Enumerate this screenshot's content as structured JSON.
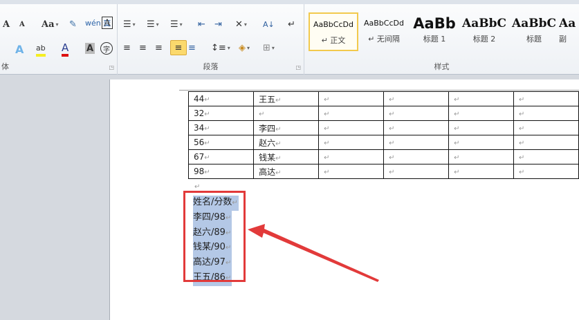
{
  "ribbon": {
    "font_group": {
      "label": "体",
      "buttons": [
        "grow-font",
        "shrink-font",
        "change-case",
        "clear-formatting",
        "phonetic-guide",
        "character-border",
        "text-effects",
        "highlight",
        "font-color",
        "character-shading",
        "enclosed-character"
      ],
      "glyphs": {
        "grow": "A",
        "shrink": "A",
        "case": "Aa",
        "phonetic": "wén 变",
        "border": "A",
        "effects": "A",
        "highlight": "ab",
        "color": "A",
        "shading": "A",
        "enclose": "字"
      }
    },
    "paragraph_group": {
      "label": "段落",
      "glyphs": {
        "bullets": "☰",
        "numbering": "☰",
        "multilevel": "☰",
        "dec_indent": "⇤",
        "inc_indent": "⇥",
        "asian_layout": "✕",
        "sort": "A↓",
        "show_marks": "↵",
        "align_left": "≡",
        "center": "≡",
        "align_right": "≡",
        "justify": "≡",
        "distributed": "≡",
        "line_spacing": "↕≡",
        "shading": "◈",
        "borders": "⊞"
      }
    },
    "styles_group": {
      "label": "样式",
      "items": [
        {
          "preview": "AaBbCcDd",
          "name": "↵ 正文",
          "active": true
        },
        {
          "preview": "AaBbCcDd",
          "name": "↵ 无间隔"
        },
        {
          "preview": "AaBb",
          "name": "标题 1"
        },
        {
          "preview": "AaBbC",
          "name": "标题 2"
        },
        {
          "preview": "AaBbC",
          "name": "标题"
        },
        {
          "preview": "Aa",
          "name": "副"
        }
      ]
    }
  },
  "table": {
    "rows": [
      [
        "44",
        "王五"
      ],
      [
        "32",
        ""
      ],
      [
        "34",
        "李四"
      ],
      [
        "56",
        "赵六"
      ],
      [
        "67",
        "钱某"
      ],
      [
        "98",
        "高达"
      ]
    ],
    "mark": "↵"
  },
  "selection": {
    "lines": [
      "姓名/分数",
      "李四/98",
      "赵六/89",
      "钱某/90",
      "高达/97",
      "王五/86"
    ]
  },
  "colors": {
    "highlight_box": "#e23a3a",
    "selection": "#b4c8e6"
  }
}
